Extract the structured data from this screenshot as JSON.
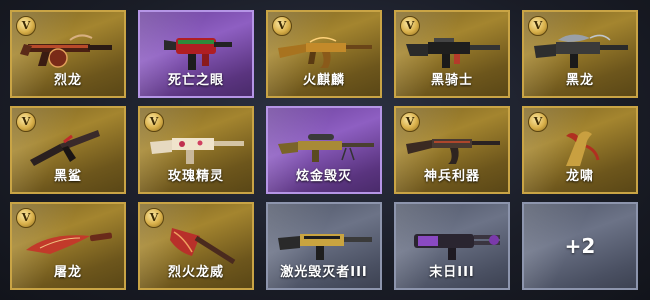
{
  "weapons": [
    {
      "label": "烈龙",
      "rarity": "gold",
      "badge": "V",
      "icon": "dragon-tommy-gun-icon"
    },
    {
      "label": "死亡之眼",
      "rarity": "purple",
      "badge": "",
      "icon": "red-smg-icon"
    },
    {
      "label": "火麒麟",
      "rarity": "gold",
      "badge": "V",
      "icon": "fire-kirin-ak-icon"
    },
    {
      "label": "黑骑士",
      "rarity": "gold",
      "badge": "V",
      "icon": "black-knight-m4-icon"
    },
    {
      "label": "黑龙",
      "rarity": "gold",
      "badge": "V",
      "icon": "black-dragon-m4-icon"
    },
    {
      "label": "黑鲨",
      "rarity": "gold",
      "badge": "V",
      "icon": "black-shark-ak-icon"
    },
    {
      "label": "玫瑰精灵",
      "rarity": "gold",
      "badge": "V",
      "icon": "rose-spirit-m4-icon"
    },
    {
      "label": "炫金毁灭",
      "rarity": "purple",
      "badge": "",
      "icon": "gold-sniper-rifle-icon"
    },
    {
      "label": "神兵利器",
      "rarity": "gold",
      "badge": "V",
      "icon": "divine-ak-icon"
    },
    {
      "label": "龙啸",
      "rarity": "gold",
      "badge": "V",
      "icon": "dragon-roar-blade-icon"
    },
    {
      "label": "屠龙",
      "rarity": "gold",
      "badge": "V",
      "icon": "dragon-slayer-knife-icon"
    },
    {
      "label": "烈火龙威",
      "rarity": "gold",
      "badge": "V",
      "icon": "fire-dragon-axe-icon"
    },
    {
      "label": "激光毁灭者III",
      "rarity": "gray",
      "badge": "",
      "icon": "laser-destroyer-rifle-icon"
    },
    {
      "label": "末日III",
      "rarity": "gray",
      "badge": "",
      "icon": "doomsday-gatling-icon"
    }
  ],
  "more_count": "+2",
  "colors": {
    "gold_border": "#c9a445",
    "purple_border": "#b595e6",
    "gray_border": "#8d95ad"
  }
}
